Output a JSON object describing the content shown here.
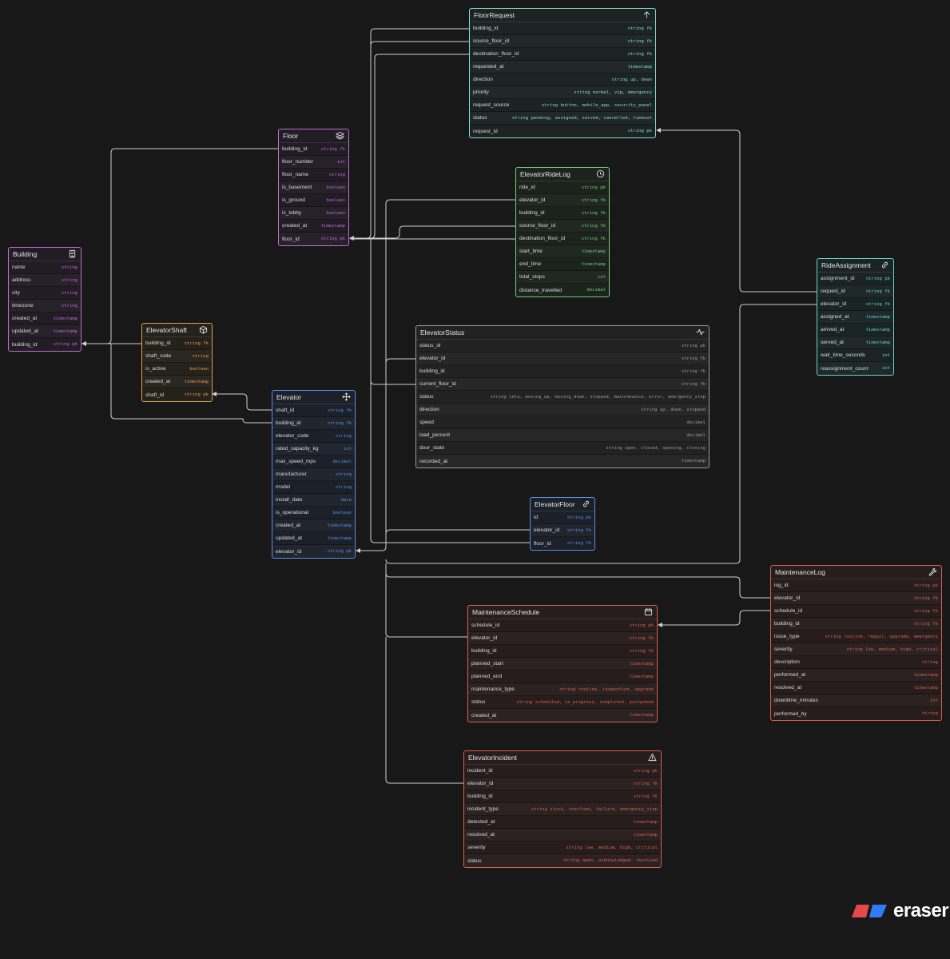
{
  "brand": {
    "name": "eraser",
    "logo_colors": [
      "#e5484d",
      "#2f7cf6"
    ]
  },
  "tables": [
    {
      "id": "FloorRequest",
      "name": "FloorRequest",
      "icon": "arrow-up-icon",
      "color": "#7fe0d3",
      "bg": "#1c2322",
      "fields": [
        {
          "name": "building_id",
          "type": "string fk"
        },
        {
          "name": "source_floor_id",
          "type": "string fk"
        },
        {
          "name": "destination_floor_id",
          "type": "string fk"
        },
        {
          "name": "requested_at",
          "type": "timestamp"
        },
        {
          "name": "direction",
          "type": "string up, down"
        },
        {
          "name": "priority",
          "type": "string normal, vip, emergency"
        },
        {
          "name": "request_source",
          "type": "string button, mobile_app, security_panel"
        },
        {
          "name": "status",
          "type": "string pending, assigned, served, cancelled, timeout"
        },
        {
          "name": "request_id",
          "type": "string pk"
        }
      ]
    },
    {
      "id": "Floor",
      "name": "Floor",
      "icon": "layers-icon",
      "color": "#c36ad6",
      "bg": "#221c24",
      "fields": [
        {
          "name": "building_id",
          "type": "string fk"
        },
        {
          "name": "floor_number",
          "type": "int"
        },
        {
          "name": "floor_name",
          "type": "string"
        },
        {
          "name": "is_basement",
          "type": "boolean"
        },
        {
          "name": "is_ground",
          "type": "boolean"
        },
        {
          "name": "is_lobby",
          "type": "boolean"
        },
        {
          "name": "created_at",
          "type": "timestamp"
        },
        {
          "name": "floor_id",
          "type": "string pk"
        }
      ]
    },
    {
      "id": "ElevatorRideLog",
      "name": "ElevatorRideLog",
      "icon": "clock-icon",
      "color": "#6fcf7b",
      "bg": "#1c231d",
      "fields": [
        {
          "name": "ride_id",
          "type": "string pk"
        },
        {
          "name": "elevator_id",
          "type": "string fk"
        },
        {
          "name": "building_id",
          "type": "string fk"
        },
        {
          "name": "source_floor_id",
          "type": "string fk"
        },
        {
          "name": "destination_floor_id",
          "type": "string fk"
        },
        {
          "name": "start_time",
          "type": "timestamp"
        },
        {
          "name": "end_time",
          "type": "timestamp"
        },
        {
          "name": "total_stops",
          "type": "int"
        },
        {
          "name": "distance_travelled",
          "type": "decimal"
        }
      ]
    },
    {
      "id": "RideAssignment",
      "name": "RideAssignment",
      "icon": "link-icon",
      "color": "#5fd6d1",
      "bg": "#1b2424",
      "fields": [
        {
          "name": "assignment_id",
          "type": "string pk"
        },
        {
          "name": "request_id",
          "type": "string fk"
        },
        {
          "name": "elevator_id",
          "type": "string fk"
        },
        {
          "name": "assigned_at",
          "type": "timestamp"
        },
        {
          "name": "arrived_at",
          "type": "timestamp"
        },
        {
          "name": "served_at",
          "type": "timestamp"
        },
        {
          "name": "wait_time_seconds",
          "type": "int"
        },
        {
          "name": "reassignment_count",
          "type": "int"
        }
      ]
    },
    {
      "id": "Building",
      "name": "Building",
      "icon": "building-icon",
      "color": "#c36ad6",
      "bg": "#221c24",
      "fields": [
        {
          "name": "name",
          "type": "string"
        },
        {
          "name": "address",
          "type": "string"
        },
        {
          "name": "city",
          "type": "string"
        },
        {
          "name": "timezone",
          "type": "string"
        },
        {
          "name": "created_at",
          "type": "timestamp"
        },
        {
          "name": "updated_at",
          "type": "timestamp"
        },
        {
          "name": "building_id",
          "type": "string pk"
        }
      ]
    },
    {
      "id": "ElevatorShaft",
      "name": "ElevatorShaft",
      "icon": "cube-icon",
      "color": "#e0a048",
      "bg": "#25211b",
      "fields": [
        {
          "name": "building_id",
          "type": "string fk"
        },
        {
          "name": "shaft_code",
          "type": "string"
        },
        {
          "name": "is_active",
          "type": "boolean"
        },
        {
          "name": "created_at",
          "type": "timestamp"
        },
        {
          "name": "shaft_id",
          "type": "string pk"
        }
      ]
    },
    {
      "id": "ElevatorStatus",
      "name": "ElevatorStatus",
      "icon": "activity-icon",
      "color": "#9a9a9a",
      "bg": "#222222",
      "fields": [
        {
          "name": "status_id",
          "type": "string pk"
        },
        {
          "name": "elevator_id",
          "type": "string fk"
        },
        {
          "name": "building_id",
          "type": "string fk"
        },
        {
          "name": "current_floor_id",
          "type": "string fk"
        },
        {
          "name": "status",
          "type": "string idle, moving_up, moving_down, stopped, maintenance, error, emergency_stop"
        },
        {
          "name": "direction",
          "type": "string up, down, stopped"
        },
        {
          "name": "speed",
          "type": "decimal"
        },
        {
          "name": "load_percent",
          "type": "decimal"
        },
        {
          "name": "door_state",
          "type": "string open, closed, opening, closing"
        },
        {
          "name": "recorded_at",
          "type": "timestamp"
        }
      ]
    },
    {
      "id": "Elevator",
      "name": "Elevator",
      "icon": "move-icon",
      "color": "#5b8ee6",
      "bg": "#1c2029",
      "fields": [
        {
          "name": "shaft_id",
          "type": "string fk"
        },
        {
          "name": "building_id",
          "type": "string fk"
        },
        {
          "name": "elevator_code",
          "type": "string"
        },
        {
          "name": "rated_capacity_kg",
          "type": "int"
        },
        {
          "name": "max_speed_mps",
          "type": "decimal"
        },
        {
          "name": "manufacturer",
          "type": "string"
        },
        {
          "name": "model",
          "type": "string"
        },
        {
          "name": "install_date",
          "type": "date"
        },
        {
          "name": "is_operational",
          "type": "boolean"
        },
        {
          "name": "created_at",
          "type": "timestamp"
        },
        {
          "name": "updated_at",
          "type": "timestamp"
        },
        {
          "name": "elevator_id",
          "type": "string pk"
        }
      ]
    },
    {
      "id": "ElevatorFloor",
      "name": "ElevatorFloor",
      "icon": "link-icon",
      "color": "#5b8ee6",
      "bg": "#1c2029",
      "fields": [
        {
          "name": "id",
          "type": "string pk"
        },
        {
          "name": "elevator_id",
          "type": "string fk"
        },
        {
          "name": "floor_id",
          "type": "string fk"
        }
      ]
    },
    {
      "id": "MaintenanceLog",
      "name": "MaintenanceLog",
      "icon": "wrench-icon",
      "color": "#d8604f",
      "bg": "#261d1c",
      "fields": [
        {
          "name": "log_id",
          "type": "string pk"
        },
        {
          "name": "elevator_id",
          "type": "string fk"
        },
        {
          "name": "schedule_id",
          "type": "string fk"
        },
        {
          "name": "building_id",
          "type": "string fk"
        },
        {
          "name": "issue_type",
          "type": "string routine, repair, upgrade, emergency"
        },
        {
          "name": "severity",
          "type": "string low, medium, high, critical"
        },
        {
          "name": "description",
          "type": "string"
        },
        {
          "name": "performed_at",
          "type": "timestamp"
        },
        {
          "name": "resolved_at",
          "type": "timestamp"
        },
        {
          "name": "downtime_minutes",
          "type": "int"
        },
        {
          "name": "performed_by",
          "type": "string"
        }
      ]
    },
    {
      "id": "MaintenanceSchedule",
      "name": "MaintenanceSchedule",
      "icon": "calendar-icon",
      "color": "#d8604f",
      "bg": "#261d1c",
      "fields": [
        {
          "name": "schedule_id",
          "type": "string pk"
        },
        {
          "name": "elevator_id",
          "type": "string fk"
        },
        {
          "name": "building_id",
          "type": "string fk"
        },
        {
          "name": "planned_start",
          "type": "timestamp"
        },
        {
          "name": "planned_end",
          "type": "timestamp"
        },
        {
          "name": "maintenance_type",
          "type": "string routine, inspection, upgrade"
        },
        {
          "name": "status",
          "type": "string scheduled, in_progress, completed, postponed"
        },
        {
          "name": "created_at",
          "type": "timestamp"
        }
      ]
    },
    {
      "id": "ElevatorIncident",
      "name": "ElevatorIncident",
      "icon": "warning-icon",
      "color": "#d8604f",
      "bg": "#261d1c",
      "fields": [
        {
          "name": "incident_id",
          "type": "string pk"
        },
        {
          "name": "elevator_id",
          "type": "string fk"
        },
        {
          "name": "building_id",
          "type": "string fk"
        },
        {
          "name": "incident_type",
          "type": "string stuck, overload, failure, emergency_stop"
        },
        {
          "name": "detected_at",
          "type": "timestamp"
        },
        {
          "name": "resolved_at",
          "type": "timestamp"
        },
        {
          "name": "severity",
          "type": "string low, medium, high, critical"
        },
        {
          "name": "status",
          "type": "string open, acknowledged, resolved"
        }
      ]
    }
  ]
}
